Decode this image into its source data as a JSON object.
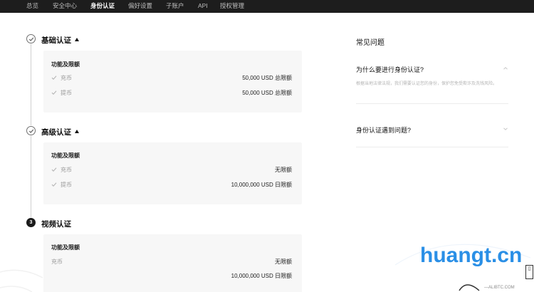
{
  "nav": {
    "items": [
      {
        "label": "总览",
        "active": false
      },
      {
        "label": "安全中心",
        "active": false
      },
      {
        "label": "身份认证",
        "active": true
      },
      {
        "label": "偏好设置",
        "active": false
      },
      {
        "label": "子账户",
        "active": false
      },
      {
        "label": "API",
        "active": false
      },
      {
        "label": "授权管理",
        "active": false
      }
    ]
  },
  "steps": [
    {
      "title": "基础认证",
      "expandable": true,
      "status": "completed",
      "card_heading": "功能及限额",
      "rows": [
        {
          "label": "充币",
          "limit": "50,000 USD 总限额",
          "checked": true
        },
        {
          "label": "提币",
          "limit": "50,000 USD 总限额",
          "checked": true
        }
      ]
    },
    {
      "title": "高级认证",
      "expandable": true,
      "status": "completed",
      "card_heading": "功能及限额",
      "rows": [
        {
          "label": "充币",
          "limit": "无限额",
          "checked": true
        },
        {
          "label": "提币",
          "limit": "10,000,000 USD 日限额",
          "checked": true
        }
      ]
    },
    {
      "title": "视频认证",
      "expandable": false,
      "status": "pending",
      "step_number": "3",
      "card_heading": "功能及限额",
      "rows": [
        {
          "label": "充币",
          "limit": "无限额",
          "checked": false
        },
        {
          "label": "",
          "limit": "10,000,000 USD 日限额",
          "checked": false
        }
      ]
    }
  ],
  "faq": {
    "title": "常见问题",
    "items": [
      {
        "question": "为什么要进行身份认证?",
        "answer": "根据当地法律法规，我们需要认证您的身份，保护您免受欺诈及洗钱风险。",
        "expanded": true
      },
      {
        "question": "身份认证遇到问题?",
        "answer": "",
        "expanded": false
      }
    ]
  },
  "watermark": {
    "brand": "huangt.cn",
    "sub": "—ALIBTC.COM"
  },
  "colors": {
    "nav_bg": "#1d1d1d",
    "card_bg": "#f7f7f7",
    "watermark_blue": "#2a8fe6"
  }
}
